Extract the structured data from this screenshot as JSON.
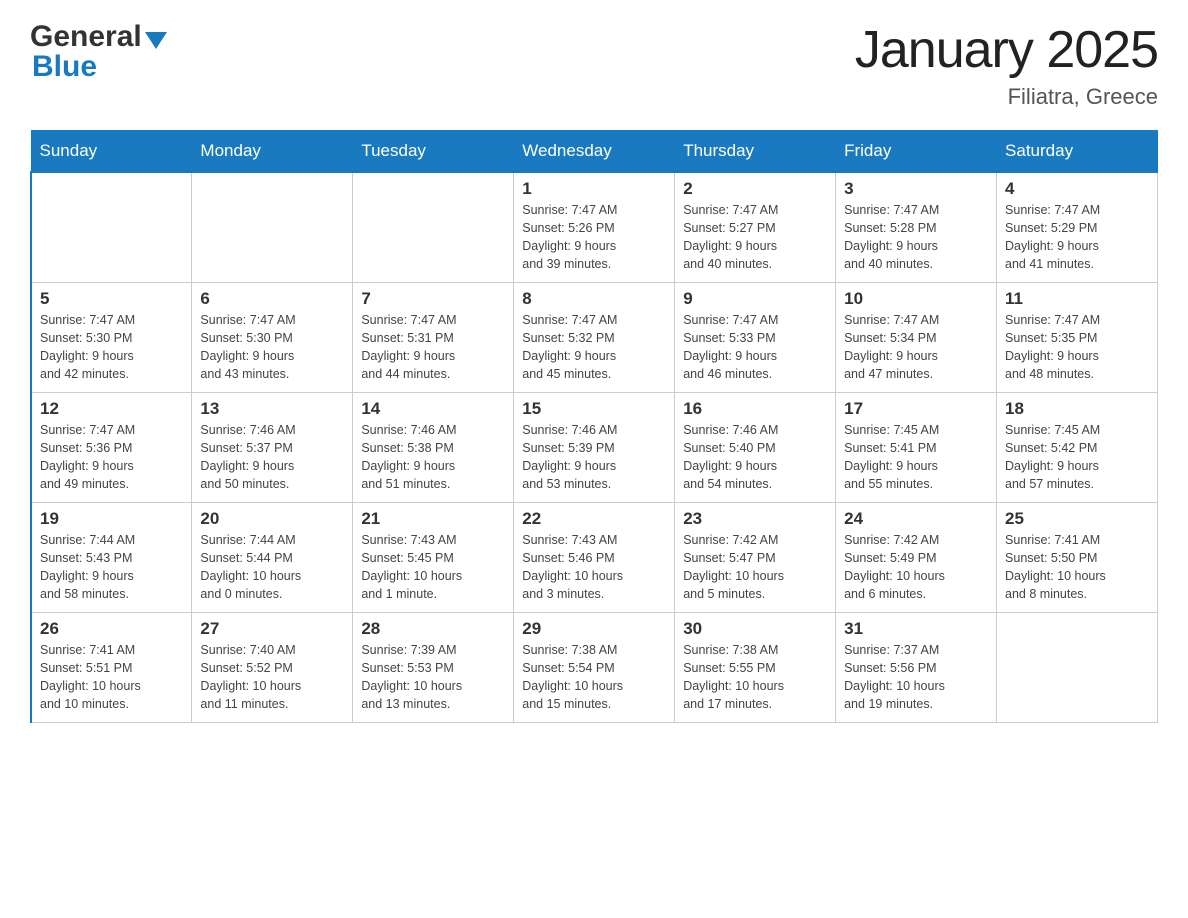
{
  "header": {
    "logo_general": "General",
    "logo_blue": "Blue",
    "title": "January 2025",
    "subtitle": "Filiatra, Greece"
  },
  "calendar": {
    "weekdays": [
      "Sunday",
      "Monday",
      "Tuesday",
      "Wednesday",
      "Thursday",
      "Friday",
      "Saturday"
    ],
    "weeks": [
      [
        {
          "day": "",
          "info": ""
        },
        {
          "day": "",
          "info": ""
        },
        {
          "day": "",
          "info": ""
        },
        {
          "day": "1",
          "info": "Sunrise: 7:47 AM\nSunset: 5:26 PM\nDaylight: 9 hours\nand 39 minutes."
        },
        {
          "day": "2",
          "info": "Sunrise: 7:47 AM\nSunset: 5:27 PM\nDaylight: 9 hours\nand 40 minutes."
        },
        {
          "day": "3",
          "info": "Sunrise: 7:47 AM\nSunset: 5:28 PM\nDaylight: 9 hours\nand 40 minutes."
        },
        {
          "day": "4",
          "info": "Sunrise: 7:47 AM\nSunset: 5:29 PM\nDaylight: 9 hours\nand 41 minutes."
        }
      ],
      [
        {
          "day": "5",
          "info": "Sunrise: 7:47 AM\nSunset: 5:30 PM\nDaylight: 9 hours\nand 42 minutes."
        },
        {
          "day": "6",
          "info": "Sunrise: 7:47 AM\nSunset: 5:30 PM\nDaylight: 9 hours\nand 43 minutes."
        },
        {
          "day": "7",
          "info": "Sunrise: 7:47 AM\nSunset: 5:31 PM\nDaylight: 9 hours\nand 44 minutes."
        },
        {
          "day": "8",
          "info": "Sunrise: 7:47 AM\nSunset: 5:32 PM\nDaylight: 9 hours\nand 45 minutes."
        },
        {
          "day": "9",
          "info": "Sunrise: 7:47 AM\nSunset: 5:33 PM\nDaylight: 9 hours\nand 46 minutes."
        },
        {
          "day": "10",
          "info": "Sunrise: 7:47 AM\nSunset: 5:34 PM\nDaylight: 9 hours\nand 47 minutes."
        },
        {
          "day": "11",
          "info": "Sunrise: 7:47 AM\nSunset: 5:35 PM\nDaylight: 9 hours\nand 48 minutes."
        }
      ],
      [
        {
          "day": "12",
          "info": "Sunrise: 7:47 AM\nSunset: 5:36 PM\nDaylight: 9 hours\nand 49 minutes."
        },
        {
          "day": "13",
          "info": "Sunrise: 7:46 AM\nSunset: 5:37 PM\nDaylight: 9 hours\nand 50 minutes."
        },
        {
          "day": "14",
          "info": "Sunrise: 7:46 AM\nSunset: 5:38 PM\nDaylight: 9 hours\nand 51 minutes."
        },
        {
          "day": "15",
          "info": "Sunrise: 7:46 AM\nSunset: 5:39 PM\nDaylight: 9 hours\nand 53 minutes."
        },
        {
          "day": "16",
          "info": "Sunrise: 7:46 AM\nSunset: 5:40 PM\nDaylight: 9 hours\nand 54 minutes."
        },
        {
          "day": "17",
          "info": "Sunrise: 7:45 AM\nSunset: 5:41 PM\nDaylight: 9 hours\nand 55 minutes."
        },
        {
          "day": "18",
          "info": "Sunrise: 7:45 AM\nSunset: 5:42 PM\nDaylight: 9 hours\nand 57 minutes."
        }
      ],
      [
        {
          "day": "19",
          "info": "Sunrise: 7:44 AM\nSunset: 5:43 PM\nDaylight: 9 hours\nand 58 minutes."
        },
        {
          "day": "20",
          "info": "Sunrise: 7:44 AM\nSunset: 5:44 PM\nDaylight: 10 hours\nand 0 minutes."
        },
        {
          "day": "21",
          "info": "Sunrise: 7:43 AM\nSunset: 5:45 PM\nDaylight: 10 hours\nand 1 minute."
        },
        {
          "day": "22",
          "info": "Sunrise: 7:43 AM\nSunset: 5:46 PM\nDaylight: 10 hours\nand 3 minutes."
        },
        {
          "day": "23",
          "info": "Sunrise: 7:42 AM\nSunset: 5:47 PM\nDaylight: 10 hours\nand 5 minutes."
        },
        {
          "day": "24",
          "info": "Sunrise: 7:42 AM\nSunset: 5:49 PM\nDaylight: 10 hours\nand 6 minutes."
        },
        {
          "day": "25",
          "info": "Sunrise: 7:41 AM\nSunset: 5:50 PM\nDaylight: 10 hours\nand 8 minutes."
        }
      ],
      [
        {
          "day": "26",
          "info": "Sunrise: 7:41 AM\nSunset: 5:51 PM\nDaylight: 10 hours\nand 10 minutes."
        },
        {
          "day": "27",
          "info": "Sunrise: 7:40 AM\nSunset: 5:52 PM\nDaylight: 10 hours\nand 11 minutes."
        },
        {
          "day": "28",
          "info": "Sunrise: 7:39 AM\nSunset: 5:53 PM\nDaylight: 10 hours\nand 13 minutes."
        },
        {
          "day": "29",
          "info": "Sunrise: 7:38 AM\nSunset: 5:54 PM\nDaylight: 10 hours\nand 15 minutes."
        },
        {
          "day": "30",
          "info": "Sunrise: 7:38 AM\nSunset: 5:55 PM\nDaylight: 10 hours\nand 17 minutes."
        },
        {
          "day": "31",
          "info": "Sunrise: 7:37 AM\nSunset: 5:56 PM\nDaylight: 10 hours\nand 19 minutes."
        },
        {
          "day": "",
          "info": ""
        }
      ]
    ]
  }
}
